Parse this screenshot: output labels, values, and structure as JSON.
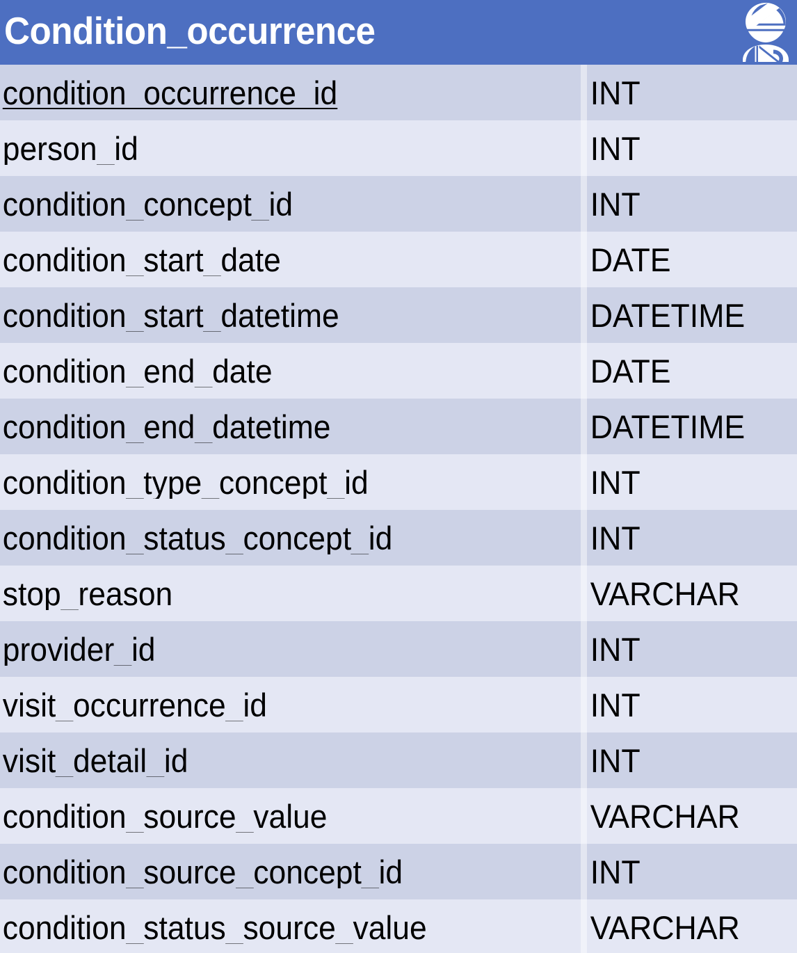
{
  "entity": {
    "title": "Condition_occurrence",
    "icon": "injured-patient-icon",
    "header_color": "#4d6fc1",
    "title_color": "#ffffff",
    "row_color_dark": "#ccd2e6",
    "row_color_light": "#e4e7f4",
    "text_color": "#000000"
  },
  "columns": {
    "name_header": "",
    "type_header": ""
  },
  "fields": [
    {
      "name": "condition_occurrence_id",
      "type": "INT",
      "primary_key": true
    },
    {
      "name": "person_id",
      "type": "INT",
      "primary_key": false
    },
    {
      "name": "condition_concept_id",
      "type": "INT",
      "primary_key": false
    },
    {
      "name": "condition_start_date",
      "type": "DATE",
      "primary_key": false
    },
    {
      "name": "condition_start_datetime",
      "type": "DATETIME",
      "primary_key": false
    },
    {
      "name": "condition_end_date",
      "type": "DATE",
      "primary_key": false
    },
    {
      "name": "condition_end_datetime",
      "type": "DATETIME",
      "primary_key": false
    },
    {
      "name": "condition_type_concept_id",
      "type": "INT",
      "primary_key": false
    },
    {
      "name": "condition_status_concept_id",
      "type": "INT",
      "primary_key": false
    },
    {
      "name": "stop_reason",
      "type": "VARCHAR",
      "primary_key": false
    },
    {
      "name": "provider_id",
      "type": "INT",
      "primary_key": false
    },
    {
      "name": "visit_occurrence_id",
      "type": "INT",
      "primary_key": false
    },
    {
      "name": "visit_detail_id",
      "type": "INT",
      "primary_key": false
    },
    {
      "name": "condition_source_value",
      "type": "VARCHAR",
      "primary_key": false
    },
    {
      "name": "condition_source_concept_id",
      "type": "INT",
      "primary_key": false
    },
    {
      "name": "condition_status_source_value",
      "type": "VARCHAR",
      "primary_key": false
    }
  ]
}
